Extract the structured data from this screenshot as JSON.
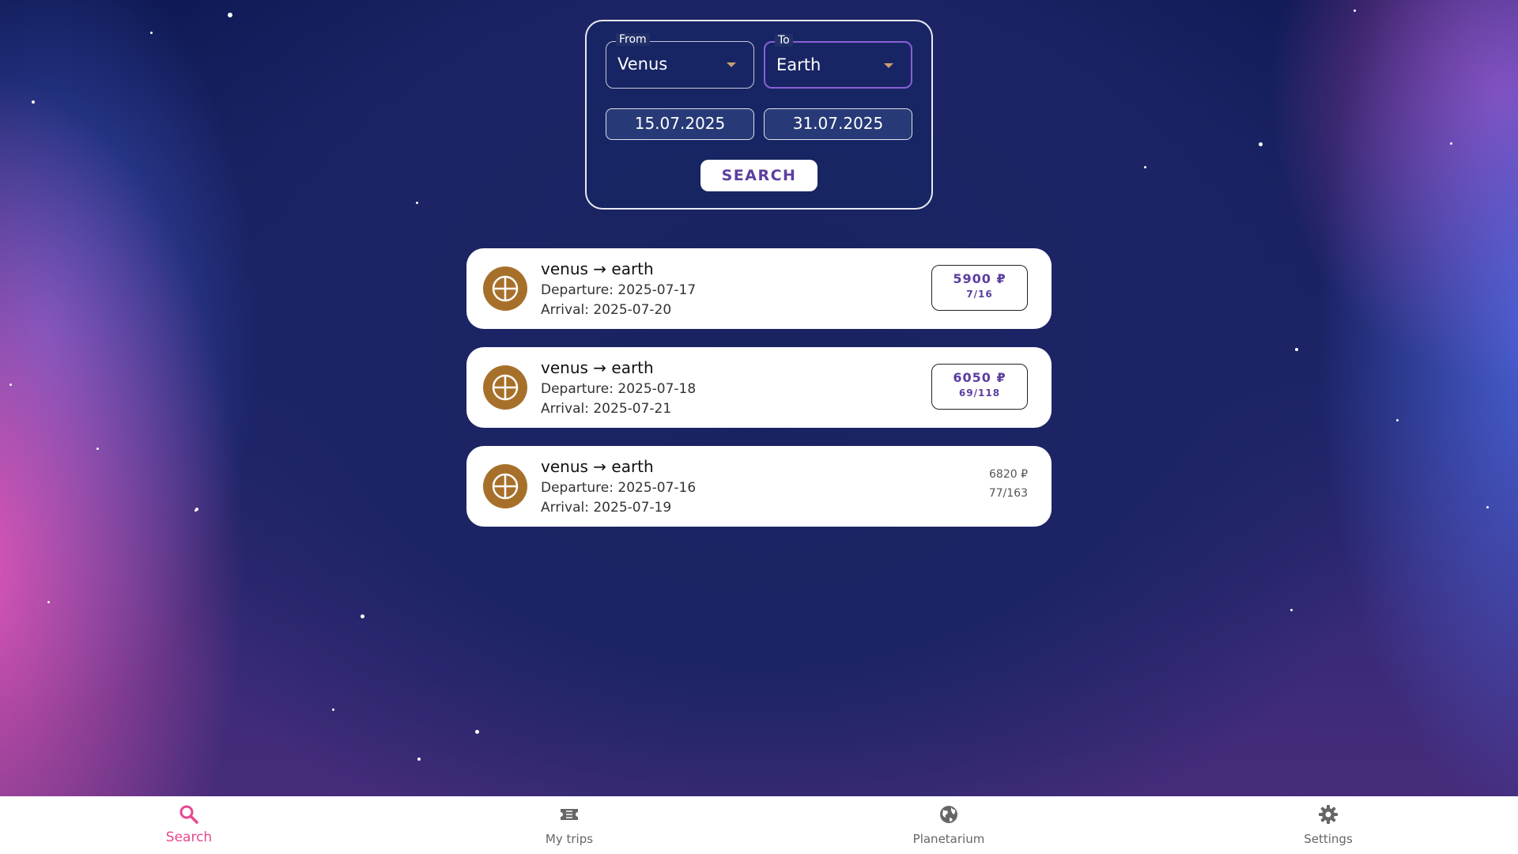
{
  "search_form": {
    "from_label": "From",
    "from_value": "Venus",
    "to_label": "To",
    "to_value": "Earth",
    "date_from": "15.07.2025",
    "date_to": "31.07.2025",
    "search_button": "SEARCH"
  },
  "results": [
    {
      "route": "venus → earth",
      "departure": "Departure: 2025-07-17",
      "arrival": "Arrival: 2025-07-20",
      "price": "5900 ₽",
      "seats": "7/16",
      "highlighted": true
    },
    {
      "route": "venus → earth",
      "departure": "Departure: 2025-07-18",
      "arrival": "Arrival: 2025-07-21",
      "price": "6050 ₽",
      "seats": "69/118",
      "highlighted": true
    },
    {
      "route": "venus → earth",
      "departure": "Departure: 2025-07-16",
      "arrival": "Arrival: 2025-07-19",
      "price": "6820 ₽",
      "seats": "77/163",
      "highlighted": false
    }
  ],
  "nav": {
    "items": [
      {
        "label": "Search",
        "icon": "search-icon",
        "active": true
      },
      {
        "label": "My trips",
        "icon": "ticket-icon",
        "active": false
      },
      {
        "label": "Planetarium",
        "icon": "globe-icon",
        "active": false
      },
      {
        "label": "Settings",
        "icon": "gear-icon",
        "active": false
      }
    ]
  },
  "colors": {
    "accent": "#5b3ea0",
    "nav_active": "#e8478f",
    "planet_icon": "#a7702a"
  }
}
